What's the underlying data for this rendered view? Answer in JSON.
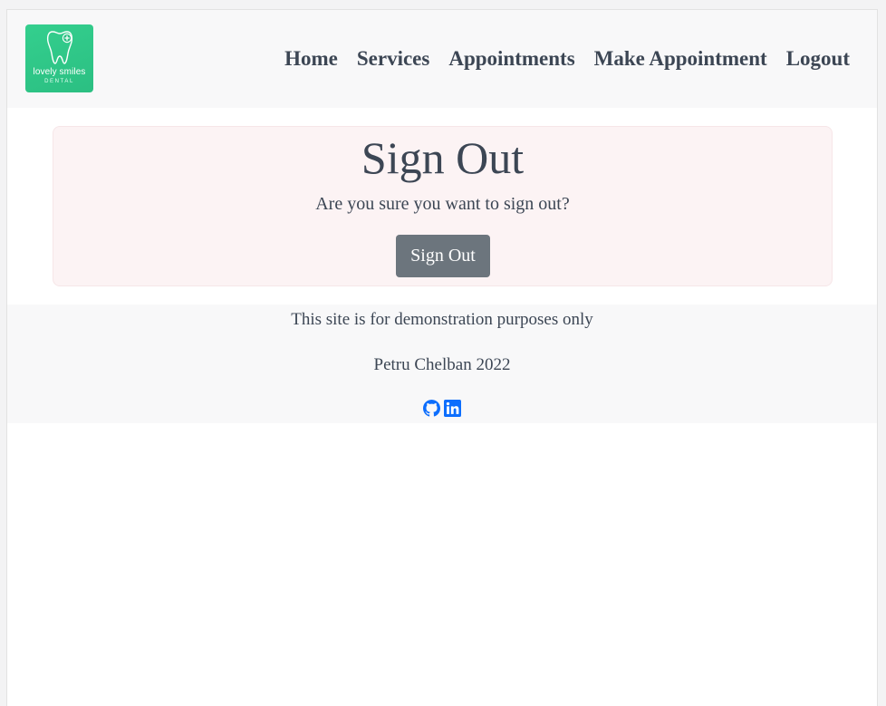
{
  "brand": {
    "name": "lovely smiles",
    "sub": "DENTAL",
    "logo_color": "#2ec786"
  },
  "nav": {
    "items": [
      "Home",
      "Services",
      "Appointments",
      "Make Appointment",
      "Logout"
    ]
  },
  "signout": {
    "title": "Sign Out",
    "message": "Are you sure you want to sign out?",
    "button_label": "Sign Out",
    "card_color": "#fcf3f4",
    "button_color": "#6c757d"
  },
  "footer": {
    "disclaimer": "This site is for demonstration purposes only",
    "credit": "Petru Chelban 2022",
    "social_icons": [
      "github-icon",
      "linkedin-icon"
    ],
    "icon_color": "#0d6efd"
  }
}
